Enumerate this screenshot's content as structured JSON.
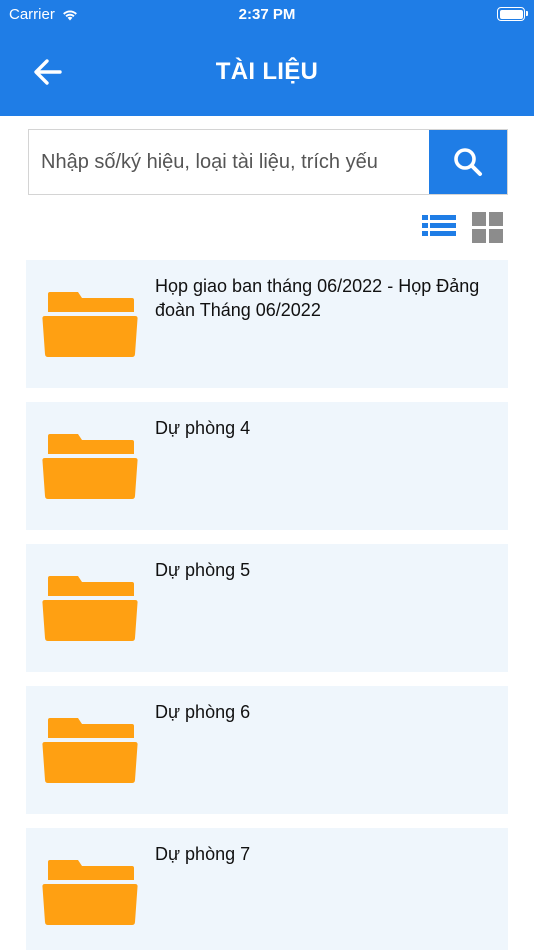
{
  "status_bar": {
    "carrier": "Carrier",
    "time": "2:37 PM"
  },
  "header": {
    "title": "TÀI LIỆU"
  },
  "search": {
    "placeholder": "Nhập số/ký hiệu, loại tài liệu, trích yếu"
  },
  "icons": {
    "back": "arrow-left-icon",
    "search": "search-icon",
    "list_view": "list-view-icon",
    "grid_view": "grid-view-icon",
    "folder": "folder-icon"
  },
  "colors": {
    "primary": "#1f7de6",
    "folder": "#ffa012",
    "card_bg": "#eff6fc",
    "grid_icon": "#8c8c8c"
  },
  "folders": [
    {
      "name": "Họp giao ban tháng 06/2022 - Họp Đảng đoàn Tháng 06/2022"
    },
    {
      "name": "Dự phòng 4"
    },
    {
      "name": "Dự phòng 5"
    },
    {
      "name": "Dự phòng 6"
    },
    {
      "name": "Dự phòng 7"
    }
  ]
}
